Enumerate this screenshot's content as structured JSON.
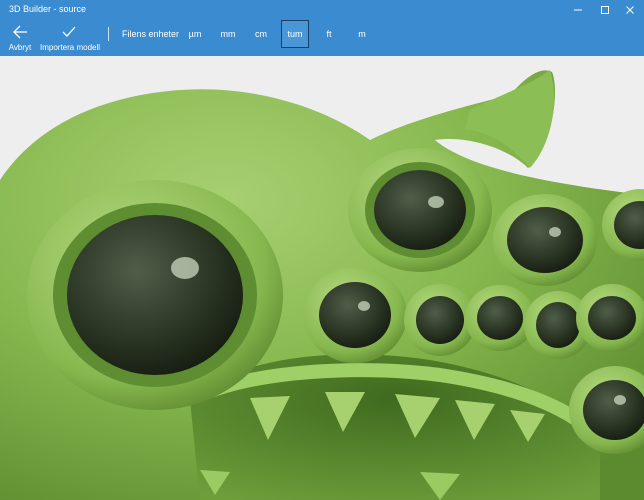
{
  "window": {
    "title": "3D Builder - source"
  },
  "toolbar": {
    "cancel_label": "Avbryt",
    "import_label": "Importera modell",
    "units_label": "Filens enheter",
    "units": [
      "µm",
      "mm",
      "cm",
      "tum",
      "ft",
      "m"
    ],
    "selected_unit": "tum"
  },
  "colors": {
    "accent": "#3a8bd0",
    "model_green": "#7fb24a"
  },
  "icons": {
    "cancel": "arrow-left-icon",
    "import": "checkmark-icon",
    "minimize": "minimize-icon",
    "maximize": "maximize-icon",
    "close": "close-icon"
  }
}
